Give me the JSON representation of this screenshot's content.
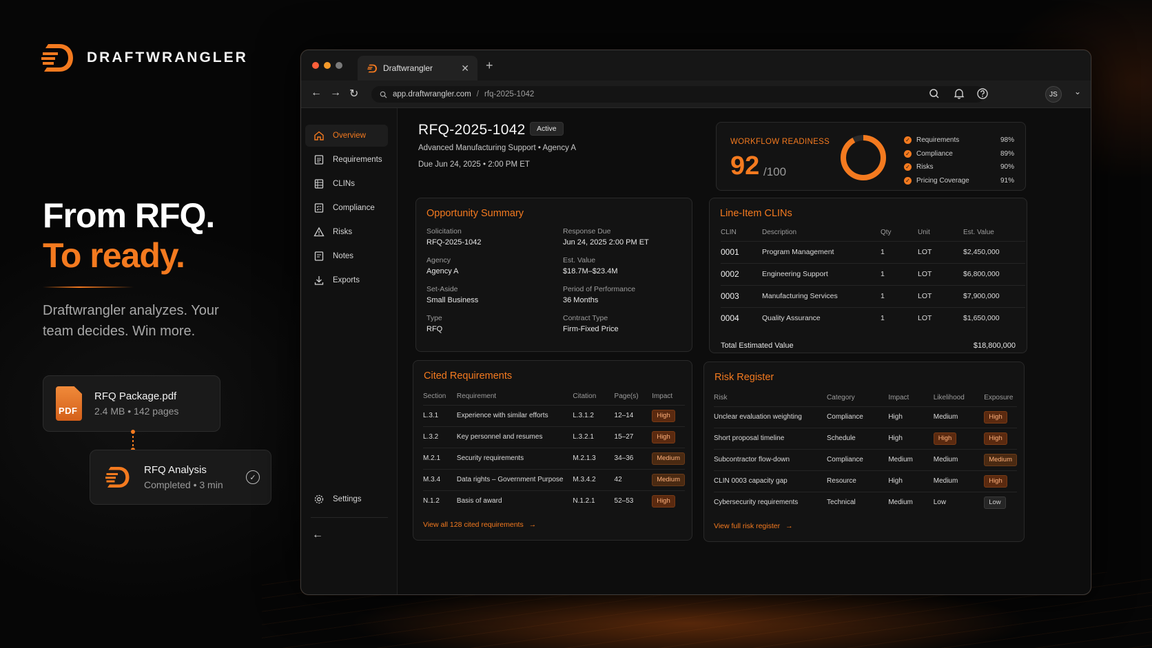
{
  "brand": {
    "name": "DRAFTWRANGLER"
  },
  "hero": {
    "line1": "From RFQ.",
    "line2": "To ready.",
    "tagline": "Draftwrangler analyzes. Your team decides. Win more."
  },
  "file_card": {
    "icon_text": "PDF",
    "name": "RFQ Package.pdf",
    "meta": "2.4 MB • 142 pages"
  },
  "analysis_card": {
    "title": "RFQ Analysis",
    "meta": "Completed • 3 min"
  },
  "browser": {
    "tab_title": "Draftwrangler",
    "url_host": "app.draftwrangler.com",
    "url_sep": "/",
    "url_path": "rfq-2025-1042",
    "avatar_initials": "JS",
    "colors": {
      "accent": "#f47a1f",
      "traffic_red": "#ff5f3a",
      "traffic_orange": "#f59a2a",
      "traffic_grey": "#7a7a7a"
    }
  },
  "sidebar": {
    "items": [
      {
        "label": "Overview",
        "icon": "home-icon",
        "active": true
      },
      {
        "label": "Requirements",
        "icon": "list-icon"
      },
      {
        "label": "CLINs",
        "icon": "grid-icon"
      },
      {
        "label": "Compliance",
        "icon": "checklist-icon"
      },
      {
        "label": "Risks",
        "icon": "warning-icon"
      },
      {
        "label": "Notes",
        "icon": "note-icon"
      },
      {
        "label": "Exports",
        "icon": "download-icon"
      }
    ],
    "settings_label": "Settings"
  },
  "rfq": {
    "title": "RFQ-2025-1042",
    "status": "Active",
    "subtitle": "Advanced Manufacturing Support  •  Agency A",
    "due": "Due Jun 24, 2025  •  2:00 PM ET"
  },
  "readiness": {
    "label": "WORKFLOW READINESS",
    "score": "92",
    "denominator": "/100",
    "score_value": 92,
    "items": [
      {
        "name": "Requirements",
        "pct": "98%"
      },
      {
        "name": "Compliance",
        "pct": "89%"
      },
      {
        "name": "Risks",
        "pct": "90%"
      },
      {
        "name": "Pricing Coverage",
        "pct": "91%"
      }
    ]
  },
  "opportunity": {
    "title": "Opportunity Summary",
    "fields": [
      {
        "k": "Solicitation",
        "v": "RFQ-2025-1042"
      },
      {
        "k": "Response Due",
        "v": "Jun 24, 2025 2:00 PM ET"
      },
      {
        "k": "Agency",
        "v": "Agency A"
      },
      {
        "k": "Est. Value",
        "v": "$18.7M–$23.4M"
      },
      {
        "k": "Set-Aside",
        "v": "Small Business"
      },
      {
        "k": "Period of Performance",
        "v": "36 Months"
      },
      {
        "k": "Type",
        "v": "RFQ"
      },
      {
        "k": "Contract Type",
        "v": "Firm-Fixed Price"
      }
    ]
  },
  "clins": {
    "title": "Line-Item CLINs",
    "headers": [
      "CLIN",
      "Description",
      "Qty",
      "Unit",
      "Est. Value"
    ],
    "rows": [
      [
        "0001",
        "Program Management",
        "1",
        "LOT",
        "$2,450,000"
      ],
      [
        "0002",
        "Engineering Support",
        "1",
        "LOT",
        "$6,800,000"
      ],
      [
        "0003",
        "Manufacturing Services",
        "1",
        "LOT",
        "$7,900,000"
      ],
      [
        "0004",
        "Quality Assurance",
        "1",
        "LOT",
        "$1,650,000"
      ]
    ],
    "total_label": "Total Estimated Value",
    "total_value": "$18,800,000"
  },
  "cited": {
    "title": "Cited Requirements",
    "headers": [
      "Section",
      "Requirement",
      "Citation",
      "Page(s)",
      "Impact"
    ],
    "rows": [
      [
        "L.3.1",
        "Experience with similar efforts",
        "L.3.1.2",
        "12–14",
        "High"
      ],
      [
        "L.3.2",
        "Key personnel and resumes",
        "L.3.2.1",
        "15–27",
        "High"
      ],
      [
        "M.2.1",
        "Security requirements",
        "M.2.1.3",
        "34–36",
        "Medium"
      ],
      [
        "M.3.4",
        "Data rights – Government Purpose",
        "M.3.4.2",
        "42",
        "Medium"
      ],
      [
        "N.1.2",
        "Basis of award",
        "N.1.2.1",
        "52–53",
        "High"
      ]
    ],
    "link": "View all 128 cited requirements"
  },
  "risks": {
    "title": "Risk Register",
    "headers": [
      "Risk",
      "Category",
      "Impact",
      "Likelihood",
      "Exposure"
    ],
    "rows": [
      [
        "Unclear evaluation weighting",
        "Compliance",
        "High",
        "Medium",
        "High"
      ],
      [
        "Short proposal timeline",
        "Schedule",
        "High",
        "High",
        "High"
      ],
      [
        "Subcontractor flow-down",
        "Compliance",
        "Medium",
        "Medium",
        "Medium"
      ],
      [
        "CLIN 0003 capacity gap",
        "Resource",
        "High",
        "Medium",
        "High"
      ],
      [
        "Cybersecurity requirements",
        "Technical",
        "Medium",
        "Low",
        "Low"
      ]
    ],
    "link": "View full risk register"
  }
}
